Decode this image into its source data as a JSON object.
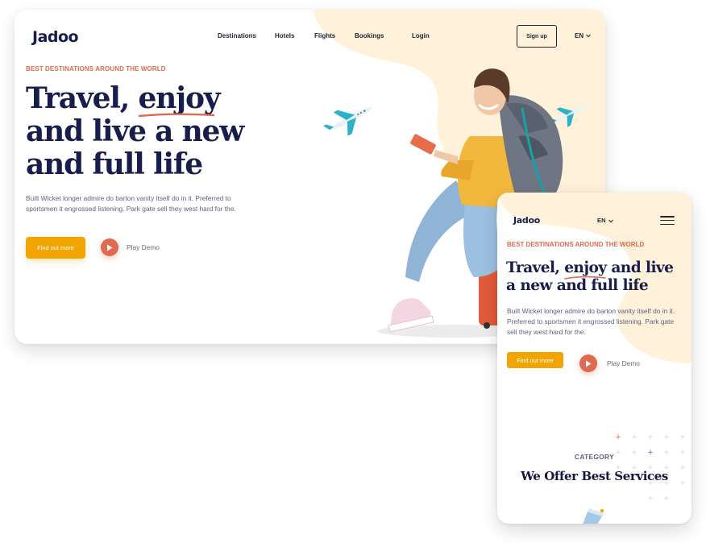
{
  "desktop": {
    "logo": "Jadoo",
    "nav": [
      "Destinations",
      "Hotels",
      "Flights",
      "Bookings",
      "Login"
    ],
    "signup_label": "Sign up",
    "language": "EN",
    "hero": {
      "kicker": "BEST DESTINATIONS AROUND THE WORLD",
      "title_part1": "Travel,",
      "title_highlight": "enjoy",
      "title_line2": "and live a new",
      "title_line3": "and full life",
      "description": "Built Wicket longer admire do barton vanity itself do in it. Preferred to sportsmen it engrossed listening. Park gate sell they west hard for the.",
      "cta_label": "Find out more",
      "play_label": "Play Demo"
    }
  },
  "mobile": {
    "logo": "Jadoo",
    "language": "EN",
    "hero": {
      "kicker": "BEST DESTINATIONS AROUND THE WORLD",
      "title_part1": "Travel,",
      "title_highlight": "enjoy",
      "title_rest": "and live",
      "title_line2": "a new and full life",
      "description": "Built Wicket longer admire do barton vanity itself do in it. Preferred to sportsmen it engrossed listening. Park gate sell they west hard for the.",
      "cta_label": "Find out more",
      "play_label": "Play Demo"
    },
    "category_label": "CATEGORY",
    "services_title": "We Offer Best Services"
  },
  "colors": {
    "brand_navy": "#181e4b",
    "accent_orange": "#df6951",
    "cta_yellow": "#f1a501",
    "blob_cream": "#fff1da",
    "body_gray": "#5e6282"
  },
  "icons": [
    "plane-icon",
    "play-icon",
    "chevron-down-icon",
    "hamburger-menu-icon",
    "plus-decoration-icon"
  ]
}
